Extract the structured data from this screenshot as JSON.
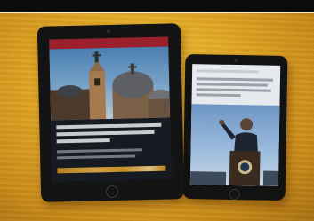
{
  "scene": {
    "subject": "two-tablets-on-wooden-desk",
    "colors": {
      "desk": "#e2a824",
      "device_body": "#141414",
      "app_header": "#9c1f2c",
      "mini_screen": "#e6eaee"
    },
    "large_tablet": {
      "screen_content": "news-article-with-church-domes-photo"
    },
    "small_tablet": {
      "screen_content": "news-article-with-speaker-at-podium-photo"
    }
  }
}
